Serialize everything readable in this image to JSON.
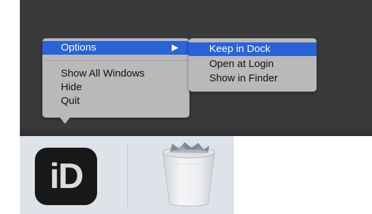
{
  "context_menu": {
    "items": [
      {
        "label": "Options",
        "has_submenu": true,
        "selected": true
      },
      {
        "label": "Show All Windows"
      },
      {
        "label": "Hide"
      },
      {
        "label": "Quit"
      }
    ]
  },
  "submenu": {
    "items": [
      {
        "label": "Keep in Dock",
        "selected": true
      },
      {
        "label": "Open at Login"
      },
      {
        "label": "Show in Finder"
      }
    ]
  },
  "dock": {
    "apps": [
      {
        "icon_text": "iD",
        "icon": "app-icon"
      },
      {
        "icon": "trash-icon"
      }
    ]
  },
  "colors": {
    "selection": "#2a62d8",
    "menu_background": "#b9b9bb",
    "desktop": "#3a3a3c",
    "dock": "#dde3e9"
  }
}
